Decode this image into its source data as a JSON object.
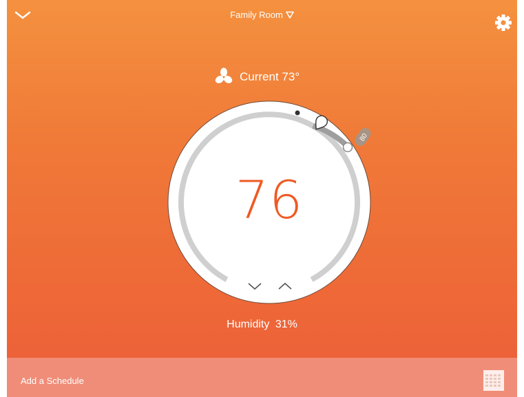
{
  "header": {
    "room_name": "Family Room",
    "collapse_icon": "chevron-down-icon",
    "room_dropdown_icon": "triangle-down-icon",
    "settings_icon": "gear-icon"
  },
  "status": {
    "fan_icon": "fan-icon",
    "current_label": "Current 73°"
  },
  "thermostat": {
    "setpoint": "76",
    "upper_limit_badge": "80",
    "decrease_icon": "chevron-down-icon",
    "increase_icon": "chevron-up-icon",
    "accent_color": "#ee5a24"
  },
  "humidity": {
    "label": "Humidity",
    "value": "31%"
  },
  "footer": {
    "schedule_label": "Add a Schedule",
    "calendar_icon": "calendar-icon"
  }
}
